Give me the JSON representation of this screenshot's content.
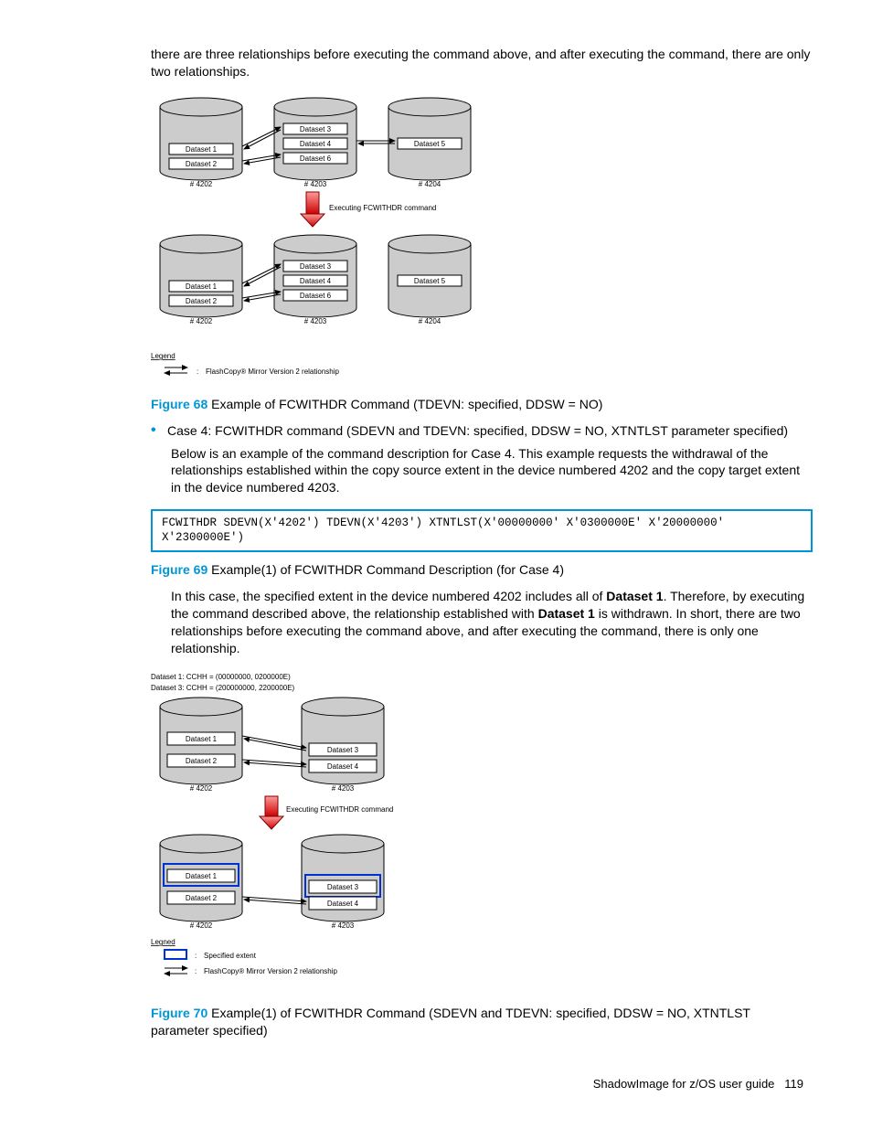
{
  "top_para": "there are three relationships before executing the command above, and after executing the command, there are only two relationships.",
  "diagram68": {
    "ds1": "Dataset 1",
    "ds2": "Dataset 2",
    "ds3": "Dataset 3",
    "ds4": "Dataset 4",
    "ds5": "Dataset 5",
    "ds6": "Dataset 6",
    "dev1": "# 4202",
    "dev2": "# 4203",
    "dev3": "# 4204",
    "exec": "Executing FCWITHDR command",
    "legend_title": "Legend",
    "legend_text": "FlashCopy® Mirror Version 2 relationship"
  },
  "fig68": {
    "label": "Figure 68",
    "text": "Example of FCWITHDR Command (TDEVN: specified, DDSW = NO)"
  },
  "case4_bullet": "Case 4: FCWITHDR command (SDEVN and TDEVN: specified, DDSW = NO, XTNTLST parameter specified)",
  "case4_para": "Below is an example of the command description for Case 4. This example requests the withdrawal of the relationships established within the copy source extent in the device numbered 4202 and the copy target extent in the device numbered 4203.",
  "code69": "FCWITHDR SDEVN(X'4202') TDEVN(X'4203') XTNTLST(X'00000000' X'0300000E' X'20000000' X'2300000E')",
  "fig69": {
    "label": "Figure 69",
    "text": "Example(1) of FCWITHDR Command Description (for Case 4)"
  },
  "mid_para_parts": {
    "p1": "In this case, the specified extent in the device numbered 4202 includes all of ",
    "b1": "Dataset 1",
    "p2": ". Therefore, by executing the command described above, the relationship established with ",
    "b2": "Dataset 1",
    "p3": " is withdrawn. In short, there are two relationships before executing the command above, and after executing the command, there is only one relationship."
  },
  "diagram70": {
    "hdr1": "Dataset 1:   CCHH = (00000000, 0200000E)",
    "hdr3": "Dataset 3:   CCHH = (200000000, 2200000E)",
    "ds1": "Dataset 1",
    "ds2": "Dataset 2",
    "ds3": "Dataset 3",
    "ds4": "Dataset 4",
    "dev1": "# 4202",
    "dev2": "# 4203",
    "exec": "Executing FCWITHDR command",
    "legend_title": "Legned",
    "legend_ext": "Specified extent",
    "legend_text": "FlashCopy® Mirror Version 2 relationship"
  },
  "fig70": {
    "label": "Figure 70",
    "text": "Example(1) of FCWITHDR Command (SDEVN and TDEVN: specified, DDSW = NO, XTNTLST parameter specified)"
  },
  "footer": {
    "title": "ShadowImage for z/OS user guide",
    "page": "119"
  }
}
